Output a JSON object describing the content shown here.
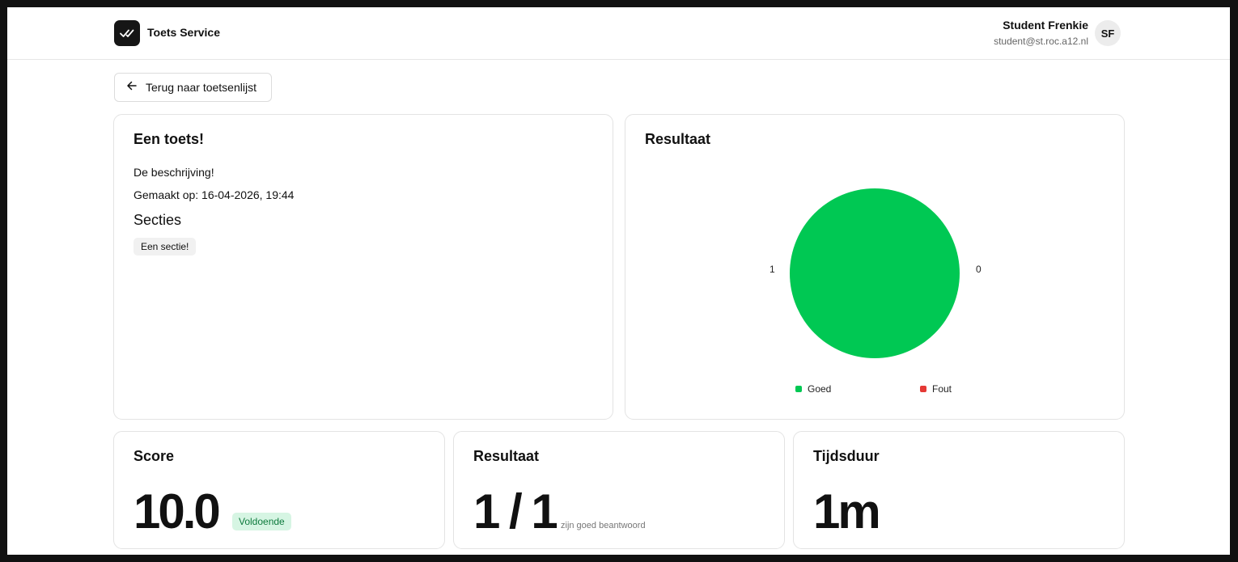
{
  "header": {
    "brand": "Toets Service",
    "user_name": "Student Frenkie",
    "user_email": "student@st.roc.a12.nl",
    "avatar_initials": "SF"
  },
  "back_button": {
    "label": "Terug naar toetsenlijst"
  },
  "test": {
    "title": "Een toets!",
    "description": "De beschrijving!",
    "created": "Gemaakt op: 16-04-2026, 19:44",
    "sections_heading": "Secties",
    "sections": [
      "Een sectie!"
    ]
  },
  "result_chart": {
    "title": "Resultaat",
    "label_left": "1",
    "label_right": "0"
  },
  "chart_data": {
    "type": "pie",
    "title": "Resultaat",
    "categories": [
      "Goed",
      "Fout"
    ],
    "values": [
      1,
      0
    ],
    "colors": [
      "#00c853",
      "#e53935"
    ],
    "legend": "bottom"
  },
  "score": {
    "title": "Score",
    "value": "10.0",
    "badge": "Voldoende",
    "badge_color": "#d6f5e3"
  },
  "result": {
    "title": "Resultaat",
    "value": "1 / 1",
    "subtext": "zijn goed beantwoord"
  },
  "duration": {
    "title": "Tijdsduur",
    "value": "1m"
  }
}
